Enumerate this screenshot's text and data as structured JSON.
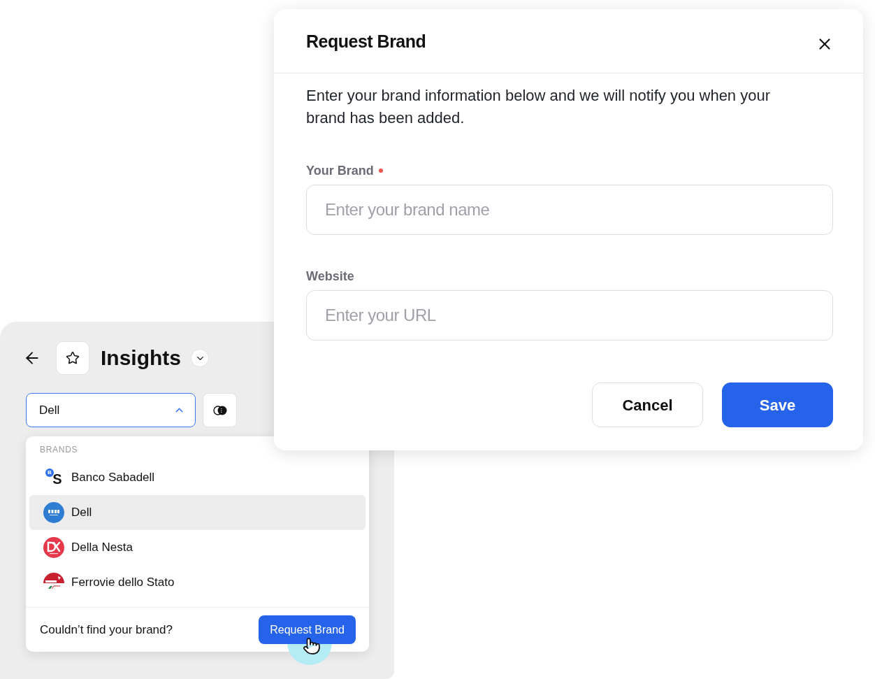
{
  "sidebar": {
    "title": "Insights",
    "select": {
      "value": "Dell",
      "expanded": true
    },
    "dropdown": {
      "section_label": "BRANDS",
      "items": [
        {
          "name": "Banco Sabadell",
          "selected": false,
          "logo": {
            "kind": "letters",
            "badge": "B",
            "mark": "S"
          }
        },
        {
          "name": "Dell",
          "selected": true,
          "logo": {
            "kind": "disc"
          }
        },
        {
          "name": "Della Nesta",
          "selected": false,
          "logo": {
            "kind": "monogram"
          }
        },
        {
          "name": "Ferrovie dello Stato",
          "selected": false,
          "logo": {
            "kind": "roundel"
          }
        }
      ],
      "footer": {
        "prompt": "Couldn’t find your brand?",
        "button": "Request Brand"
      }
    }
  },
  "modal": {
    "title": "Request Brand",
    "description": "Enter your brand information below and we will notify you when your brand has been added.",
    "fields": [
      {
        "label": "Your Brand",
        "required": true,
        "placeholder": "Enter your brand name"
      },
      {
        "label": "Website",
        "required": false,
        "placeholder": "Enter your URL"
      }
    ],
    "buttons": [
      {
        "label": "Cancel",
        "kind": "secondary"
      },
      {
        "label": "Save",
        "kind": "primary"
      }
    ]
  }
}
